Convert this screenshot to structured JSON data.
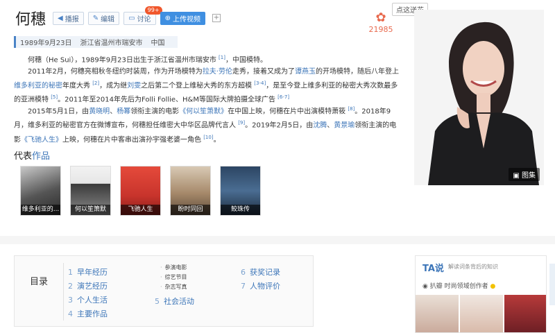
{
  "header": {
    "title": "何穗",
    "buttons": [
      {
        "label": "播报",
        "icon": "speaker-icon"
      },
      {
        "label": "编辑",
        "icon": "pencil-icon"
      },
      {
        "label": "讨论",
        "icon": "chat-icon",
        "badge": "99+"
      },
      {
        "label": "上传视频",
        "icon": "upload-icon"
      }
    ]
  },
  "flower": {
    "count": "21985",
    "tooltip": "点这送花"
  },
  "meta": [
    "1989年9月23日",
    "浙江省温州市瑞安市",
    "中国"
  ],
  "paragraphs": {
    "p1": {
      "a": "何穗（He Sui），1989年9月23日出生于浙江省温州市瑞安市 ",
      "ref": "[1]",
      "b": "，中国模特。"
    },
    "p2": {
      "a": "2011年2月，何穗亮相秋冬纽约时装周，作为开场模特为",
      "l1": "拉夫·劳伦",
      "b": "走秀，接着又成为了",
      "l2": "谭燕玉",
      "c": "的开场模特，随后八年登上",
      "l3": "维多利亚的秘密",
      "d": "年度大秀 ",
      "r1": "[2]",
      "e": "，成为继",
      "l4": "刘雯",
      "f": "之后第二个登上维秘大秀的东方超模 ",
      "r2": "[3-4]",
      "g": "，是至今登上维多利亚的秘密大秀次数最多的亚洲模特 ",
      "r3": "[5]",
      "h": "。2011年至2014年先后为Folli Follie、H&M等国际大牌拍摄全球广告 ",
      "r4": "[6-7]"
    },
    "p3": {
      "a": "2015年5月1日，由",
      "l1": "黄晓明",
      "b": "、",
      "l2": "杨幂",
      "c": "领衔主演的电影",
      "l3": "《何以笙箫默》",
      "d": "在中国上映，何穗在片中出演模特萧筱 ",
      "r1": "[8]",
      "e": "。2018年9月，维多利亚的秘密官方在微博宣布，何穗担任维密大中华区品牌代言人 ",
      "r2": "[9]",
      "f": "。2019年2月5日，由",
      "l4": "沈腾",
      "g": "、",
      "l5": "黄景瑜",
      "h": "领衔主演的电影",
      "l6": "《飞驰人生》",
      "i": "上映，何穗在片中客串出演孙宇强老婆一角色 ",
      "r3": "[10]",
      "j": "。"
    }
  },
  "works": {
    "head1": "代表",
    "head2": "作品",
    "items": [
      "维多利亚的...",
      "何以笙箫默",
      "飞驰人生",
      "盼时同回",
      "鲛珠传"
    ]
  },
  "photo": {
    "gallery_label": "图集"
  },
  "toc": {
    "label": "目录",
    "col1": [
      {
        "num": "1",
        "text": "早年经历"
      },
      {
        "num": "2",
        "text": "演艺经历"
      },
      {
        "num": "3",
        "text": "个人生活"
      },
      {
        "num": "4",
        "text": "主要作品"
      }
    ],
    "col2_subs": [
      "参演电影",
      "综艺节目",
      "杂志写真"
    ],
    "col2_main": {
      "num": "5",
      "text": "社会活动"
    },
    "col3": [
      {
        "num": "6",
        "text": "获奖记录"
      },
      {
        "num": "7",
        "text": "人物评价"
      }
    ]
  },
  "ta": {
    "logo": "TA说",
    "slogan": "解读词条背后的知识",
    "author": "扒瓣 时尚领域创作者"
  },
  "colors": {
    "link": "#3c75b8",
    "accent": "#3f8fe1",
    "flower": "#e86a4e",
    "badge": "#f0572c"
  }
}
